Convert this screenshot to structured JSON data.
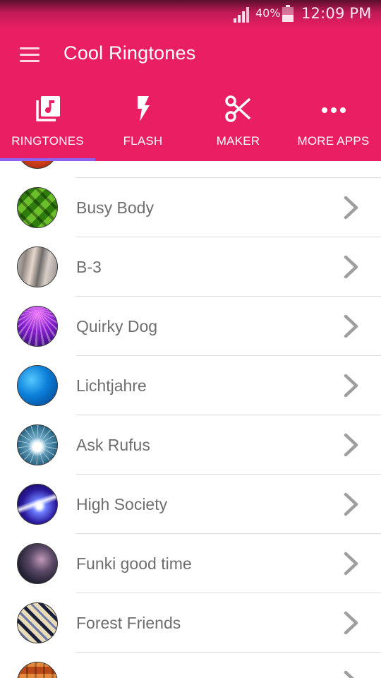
{
  "status_bar": {
    "battery_percent": "40%",
    "time": "12:09 PM",
    "signal_icon": "signal-icon",
    "battery_icon": "battery-icon"
  },
  "app_bar": {
    "title": "Cool Ringtones",
    "menu_icon": "hamburger-menu-icon",
    "color": "#e91e63"
  },
  "tabs": [
    {
      "label": "RINGTONES",
      "icon": "music-library-icon",
      "selected": true
    },
    {
      "label": "FLASH",
      "icon": "flash-icon",
      "selected": false
    },
    {
      "label": "MAKER",
      "icon": "scissors-icon",
      "selected": false
    },
    {
      "label": "MORE APPS",
      "icon": "more-dots-icon",
      "selected": false
    }
  ],
  "tab_indicator_color": "#8c63ee",
  "ringtones": [
    {
      "label": "Busy Body"
    },
    {
      "label": "B-3"
    },
    {
      "label": "Quirky Dog"
    },
    {
      "label": "Lichtjahre"
    },
    {
      "label": "Ask Rufus"
    },
    {
      "label": "High Society"
    },
    {
      "label": "Funki good time"
    },
    {
      "label": "Forest Friends"
    }
  ]
}
